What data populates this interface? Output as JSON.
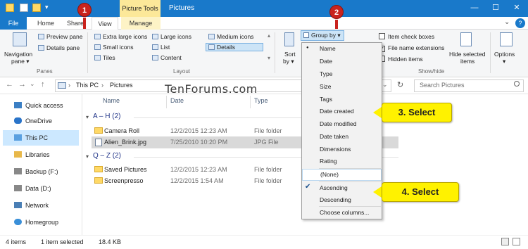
{
  "window": {
    "context_tab": "Picture Tools",
    "title": "Pictures",
    "min_glyph": "—",
    "max_glyph": "☐",
    "close_glyph": "✕",
    "help_glyph": "?",
    "expand_glyph": "⌄"
  },
  "tabs": [
    "File",
    "Home",
    "Share",
    "View",
    "Manage"
  ],
  "ribbon": {
    "panes": {
      "navigation_pane": "Navigation",
      "navigation_pane2": "pane ▾",
      "preview_pane": "Preview pane",
      "details_pane": "Details pane",
      "group_label": "Panes"
    },
    "layout": {
      "items": [
        "Extra large icons",
        "Large icons",
        "Medium icons",
        "Small icons",
        "List",
        "Details",
        "Tiles",
        "Content"
      ],
      "group_label": "Layout"
    },
    "current_view": {
      "sort_label": "Sort",
      "sort_label2": "by ▾",
      "group_by": "Group by ▾"
    },
    "show_hide": {
      "item_check_boxes": "Item check boxes",
      "file_name_extensions": "File name extensions",
      "hidden_items": "Hidden items",
      "hide_selected": "Hide selected",
      "hide_selected2": "items",
      "group_label": "Show/hide"
    },
    "options": "Options",
    "options2": "▾"
  },
  "address": {
    "path": [
      "This PC",
      "Pictures"
    ],
    "search_placeholder": "Search Pictures",
    "back_glyph": "←",
    "forward_glyph": "→",
    "down_glyph": "⌄",
    "up_glyph": "↑",
    "refresh_glyph": "↻",
    "sep_glyph": "›"
  },
  "sidebar": {
    "items": [
      "Quick access",
      "OneDrive",
      "This PC",
      "Libraries",
      "Backup (F:)",
      "Data (D:)",
      "Network",
      "Homegroup"
    ]
  },
  "columns": [
    "Name",
    "Date",
    "Type"
  ],
  "groups": [
    {
      "header": "A – H (2)",
      "rows": [
        {
          "name": "Camera Roll",
          "date": "12/2/2015 12:23 AM",
          "type": "File folder"
        },
        {
          "name": "Alien_Brink.jpg",
          "date": "7/25/2010 10:20 PM",
          "type": "JPG File"
        }
      ]
    },
    {
      "header": "Q – Z (2)",
      "rows": [
        {
          "name": "Saved Pictures",
          "date": "12/2/2015 12:23 AM",
          "type": "File folder"
        },
        {
          "name": "Screenpresso",
          "date": "12/2/2015 1:54 AM",
          "type": "File folder"
        }
      ]
    }
  ],
  "group_by_menu": {
    "items": [
      "Name",
      "Date",
      "Type",
      "Size",
      "Tags",
      "Date created",
      "Date modified",
      "Date taken",
      "Dimensions",
      "Rating",
      "(None)",
      "Ascending",
      "Descending",
      "Choose columns..."
    ],
    "bullet_glyph": "●",
    "check_glyph": "✔"
  },
  "status": {
    "count": "4 items",
    "selected": "1 item selected",
    "size": "18.4 KB"
  },
  "callouts": {
    "step1": "1",
    "step2": "2",
    "step3": "3. Select",
    "step4": "4. Select"
  },
  "watermark": "TenForums.com",
  "colors": {
    "titlebar": "#1979ca",
    "picture_tools": "#fce899",
    "selection": "#cce8ff",
    "callout": "#fff200",
    "step_circle": "#c9231e"
  }
}
